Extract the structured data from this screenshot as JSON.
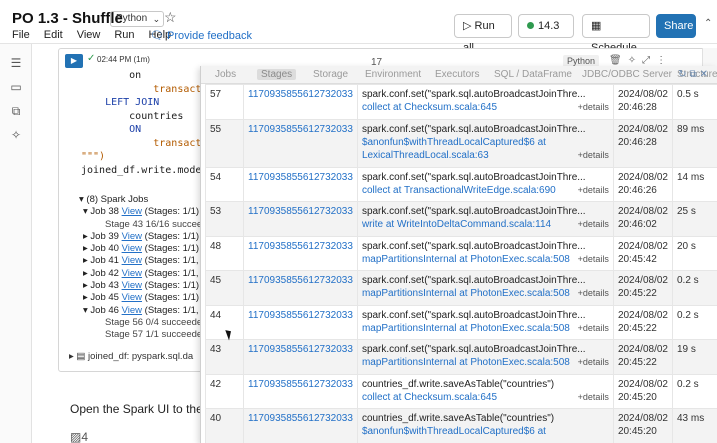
{
  "header": {
    "title": "PO 1.3 - Shuffle",
    "language": "Python",
    "menu": [
      "File",
      "Edit",
      "View",
      "Run",
      "Help"
    ],
    "feedback_label": "Provide feedback",
    "run_all_label": "Run all",
    "cluster_label": "14.3",
    "schedule_label": "Schedule",
    "share_label": "Share"
  },
  "cell": {
    "exec_info": "02:44 PM (1m)",
    "number": "17",
    "language": "Python",
    "code_lines": [
      "        on",
      "            transaction",
      "    LEFT JOIN",
      "        countries",
      "        ON",
      "            transaction",
      "\"\"\")",
      "",
      "joined_df.write.mode('o"
    ],
    "spark_jobs_header": "(8) Spark Jobs",
    "jobs": [
      {
        "label": "Job 38",
        "link": "View",
        "stages": "(Stages: 1/1)",
        "expanded": true
      },
      {
        "sub": "Stage 43  16/16 succeed"
      },
      {
        "label": "Job 39",
        "link": "View",
        "stages": "(Stages: 1/1)"
      },
      {
        "label": "Job 40",
        "link": "View",
        "stages": "(Stages: 1/1)"
      },
      {
        "label": "Job 41",
        "link": "View",
        "stages": "(Stages: 1/1, 2"
      },
      {
        "label": "Job 42",
        "link": "View",
        "stages": "(Stages: 1/1, 4"
      },
      {
        "label": "Job 43",
        "link": "View",
        "stages": "(Stages: 1/1)"
      },
      {
        "label": "Job 45",
        "link": "View",
        "stages": "(Stages: 1/1)"
      },
      {
        "label": "Job 46",
        "link": "View",
        "stages": "(Stages: 1/1, 1",
        "expanded": true
      },
      {
        "sub": "Stage 56  0/4 succeeded"
      },
      {
        "sub": "Stage 57  1/1 succeeded"
      }
    ],
    "df_label": "joined_df:  pyspark.sql.da"
  },
  "doc_text": "Open the Spark UI to the St",
  "img_alt": "4",
  "spark_ui": {
    "tabs": [
      "Jobs",
      "Stages",
      "Storage",
      "Environment",
      "Executors",
      "SQL / DataFrame",
      "JDBC/ODBC Server",
      "Structured"
    ],
    "active_tab": "Stages",
    "rows": [
      {
        "id": "57",
        "job": "1170935855612732033",
        "cmd": "spark.conf.set(\"spark.sql.autoBroadcastJoinThre...",
        "site": "collect at Checksum.scala:645",
        "site2": "",
        "details": "+details",
        "date": "2024/08/02",
        "time": "20:46:28",
        "dur": "0.5 s"
      },
      {
        "id": "55",
        "job": "1170935855612732033",
        "cmd": "spark.conf.set(\"spark.sql.autoBroadcastJoinThre...",
        "site": "$anonfun$withThreadLocalCaptured$6 at",
        "site2": "LexicalThreadLocal.scala:63",
        "details": "+details",
        "date": "2024/08/02",
        "time": "20:46:28",
        "dur": "89 ms"
      },
      {
        "id": "54",
        "job": "1170935855612732033",
        "cmd": "spark.conf.set(\"spark.sql.autoBroadcastJoinThre...",
        "site": "collect at TransactionalWriteEdge.scala:690",
        "site2": "",
        "details": "+details",
        "date": "2024/08/02",
        "time": "20:46:26",
        "dur": "14 ms"
      },
      {
        "id": "53",
        "job": "1170935855612732033",
        "cmd": "spark.conf.set(\"spark.sql.autoBroadcastJoinThre...",
        "site": "write at WriteIntoDeltaCommand.scala:114",
        "site2": "",
        "details": "+details",
        "date": "2024/08/02",
        "time": "20:46:02",
        "dur": "25 s"
      },
      {
        "id": "48",
        "job": "1170935855612732033",
        "cmd": "spark.conf.set(\"spark.sql.autoBroadcastJoinThre...",
        "site": "mapPartitionsInternal at PhotonExec.scala:508",
        "site2": "",
        "details": "+details",
        "date": "2024/08/02",
        "time": "20:45:42",
        "dur": "20 s"
      },
      {
        "id": "45",
        "job": "1170935855612732033",
        "cmd": "spark.conf.set(\"spark.sql.autoBroadcastJoinThre...",
        "site": "mapPartitionsInternal at PhotonExec.scala:508",
        "site2": "",
        "details": "+details",
        "date": "2024/08/02",
        "time": "20:45:22",
        "dur": "0.2 s"
      },
      {
        "id": "44",
        "job": "1170935855612732033",
        "cmd": "spark.conf.set(\"spark.sql.autoBroadcastJoinThre...",
        "site": "mapPartitionsInternal at PhotonExec.scala:508",
        "site2": "",
        "details": "+details",
        "date": "2024/08/02",
        "time": "20:45:22",
        "dur": "0.2 s"
      },
      {
        "id": "43",
        "job": "1170935855612732033",
        "cmd": "spark.conf.set(\"spark.sql.autoBroadcastJoinThre...",
        "site": "mapPartitionsInternal at PhotonExec.scala:508",
        "site2": "",
        "details": "+details",
        "date": "2024/08/02",
        "time": "20:45:22",
        "dur": "19 s"
      },
      {
        "id": "42",
        "job": "1170935855612732033",
        "cmd": "countries_df.write.saveAsTable(\"countries\")",
        "site": "collect at Checksum.scala:645",
        "site2": "",
        "details": "+details",
        "date": "2024/08/02",
        "time": "20:45:20",
        "dur": "0.2 s"
      },
      {
        "id": "40",
        "job": "1170935855612732033",
        "cmd": "countries_df.write.saveAsTable(\"countries\")",
        "site": "$anonfun$withThreadLocalCaptured$6 at",
        "site2": "",
        "details": "",
        "date": "2024/08/02",
        "time": "20:45:20",
        "dur": "43 ms"
      }
    ]
  }
}
